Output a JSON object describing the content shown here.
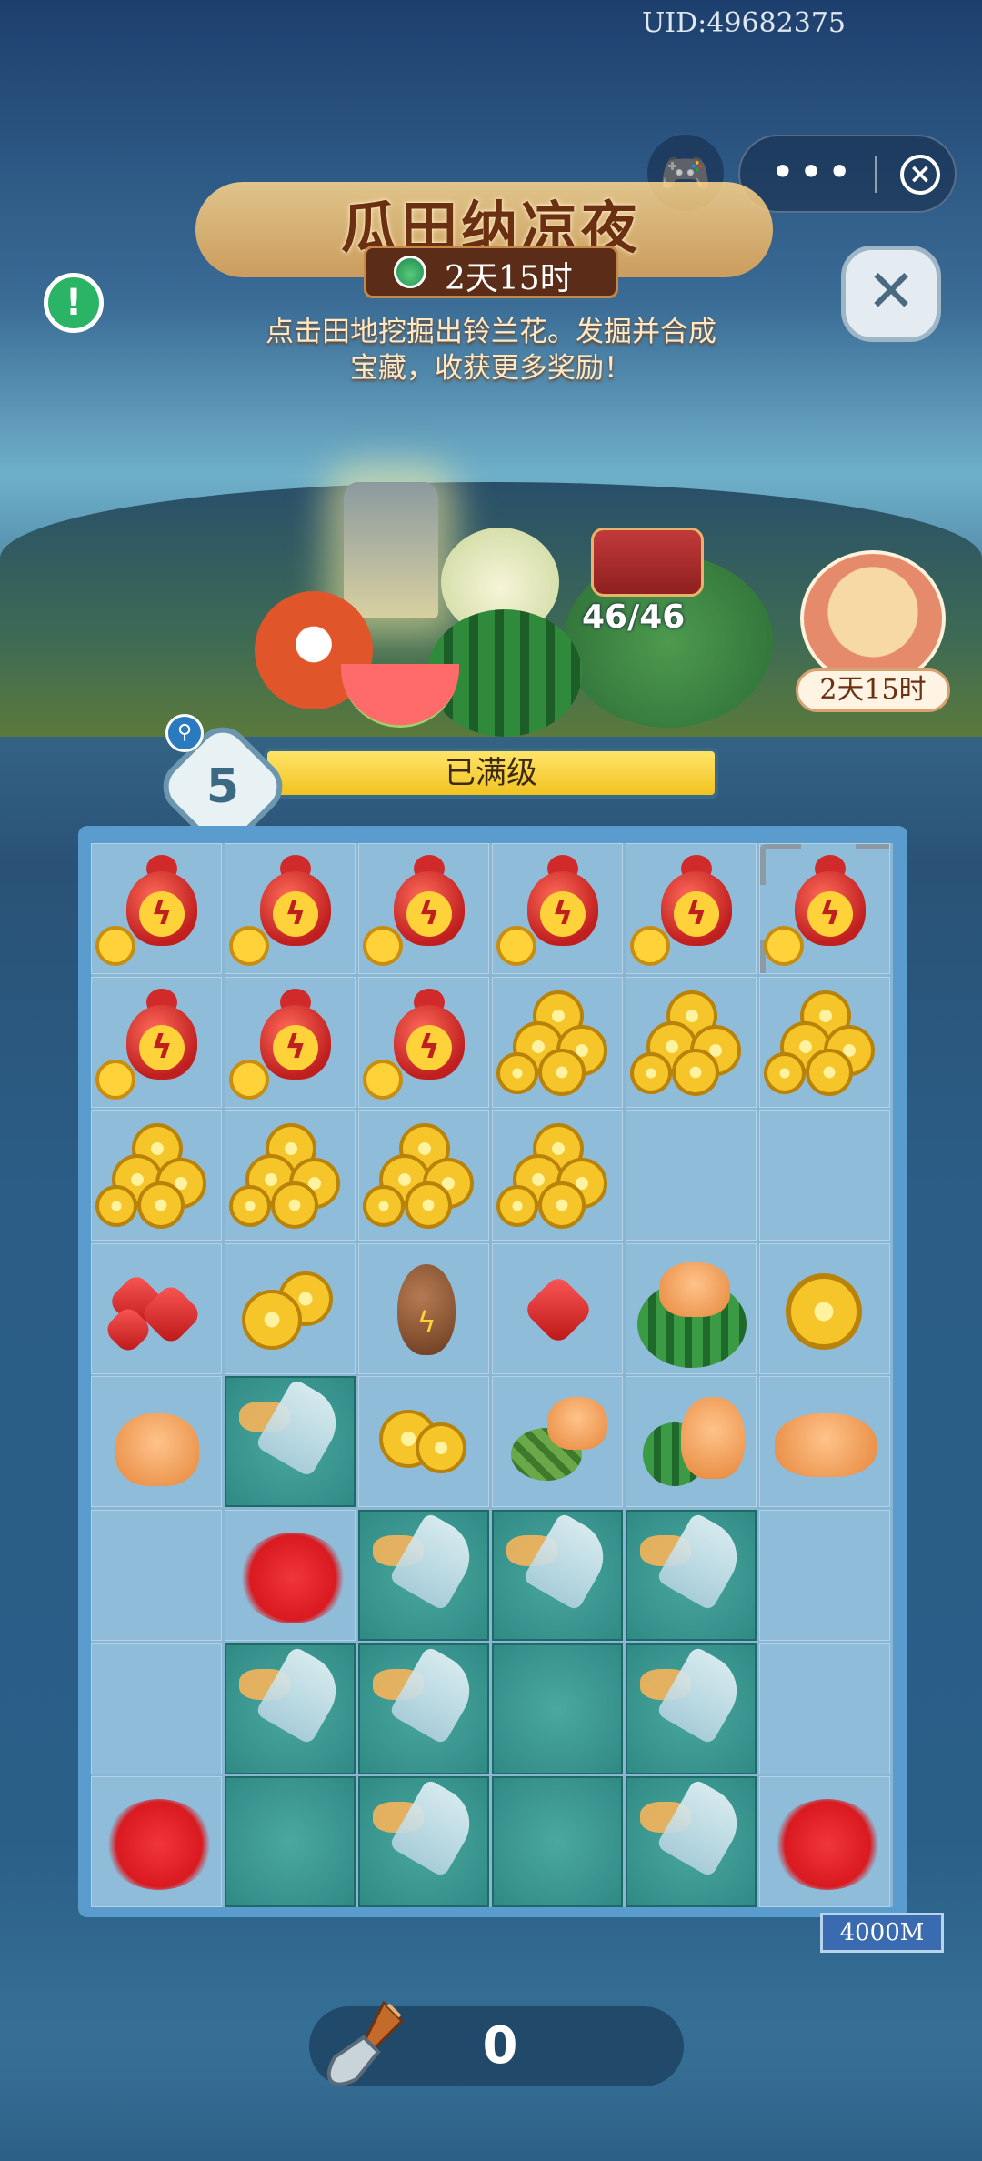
{
  "header": {
    "uid": "UID:49682375",
    "title": "瓜田纳凉夜",
    "timer": "2天15时",
    "description_line1": "点击田地挖掘出铃兰花。发掘并合成",
    "description_line2": "宝藏，收获更多奖励！"
  },
  "scene": {
    "pieces_count": "46/46",
    "cat_event_timer": "2天15时"
  },
  "level": {
    "number": "5",
    "status": "已满级"
  },
  "board": {
    "columns": 6,
    "rows": 8,
    "cells": [
      [
        "gourd",
        "gourd",
        "gourd",
        "gourd",
        "gourd",
        "gourd-selected"
      ],
      [
        "gourd",
        "gourd",
        "gourd",
        "coins",
        "coins",
        "coins"
      ],
      [
        "coins",
        "coins",
        "coins",
        "coins",
        "empty",
        "empty"
      ],
      [
        "red-gems",
        "coin-stack",
        "brown-gourd",
        "red-gem",
        "watermelon-cat",
        "single-coin"
      ],
      [
        "sleeping-cat",
        "soil-shovel",
        "two-coins",
        "turtle-cat",
        "melon-cat",
        "lying-cat"
      ],
      [
        "empty",
        "scribble",
        "soil-shovel",
        "soil-shovel",
        "soil-shovel",
        "empty"
      ],
      [
        "empty",
        "soil-shovel",
        "soil-shovel",
        "soil",
        "soil-shovel",
        "empty"
      ],
      [
        "scribble",
        "soil",
        "soil-shovel",
        "soil",
        "soil-shovel",
        "scribble"
      ]
    ]
  },
  "footer": {
    "depth": "4000M",
    "shovel_count": "0"
  },
  "colors": {
    "accent_gold": "#f2c320",
    "soil_teal": "#2f8a84",
    "board_blue": "#8fbcd9"
  },
  "icons": {
    "gamepad": "gamepad-icon",
    "more": "more-icon",
    "close": "close-circle-icon",
    "info": "info-icon",
    "shovel": "shovel-icon"
  }
}
